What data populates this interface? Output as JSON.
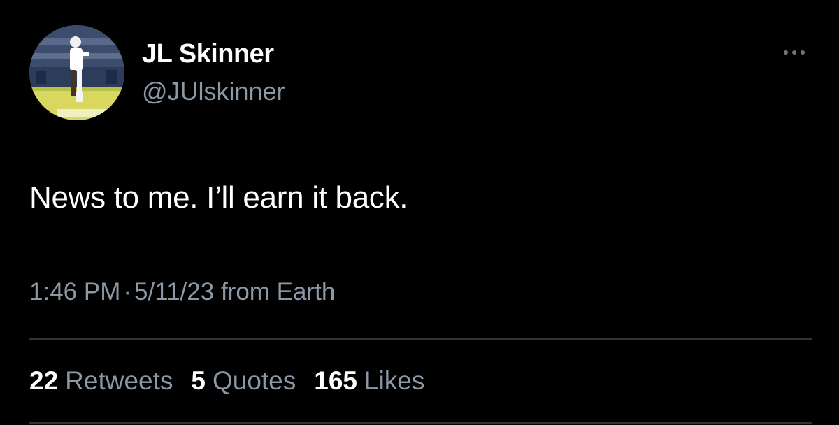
{
  "tweet": {
    "author": {
      "display_name": "JL Skinner",
      "handle": "@JUlskinner"
    },
    "text": "News to me. I’ll earn it back.",
    "time": "1:46 PM",
    "separator": "·",
    "date": "5/11/23",
    "source": "from Earth",
    "stats": {
      "retweets": {
        "count": "22",
        "label": "Retweets"
      },
      "quotes": {
        "count": "5",
        "label": "Quotes"
      },
      "likes": {
        "count": "165",
        "label": "Likes"
      }
    }
  },
  "icons": {
    "more": "more-options-icon",
    "avatar": "profile-photo"
  },
  "colors": {
    "background": "#000000",
    "primary_text": "#ffffff",
    "secondary_text": "#8b98a5",
    "divider": "#2f3336"
  }
}
